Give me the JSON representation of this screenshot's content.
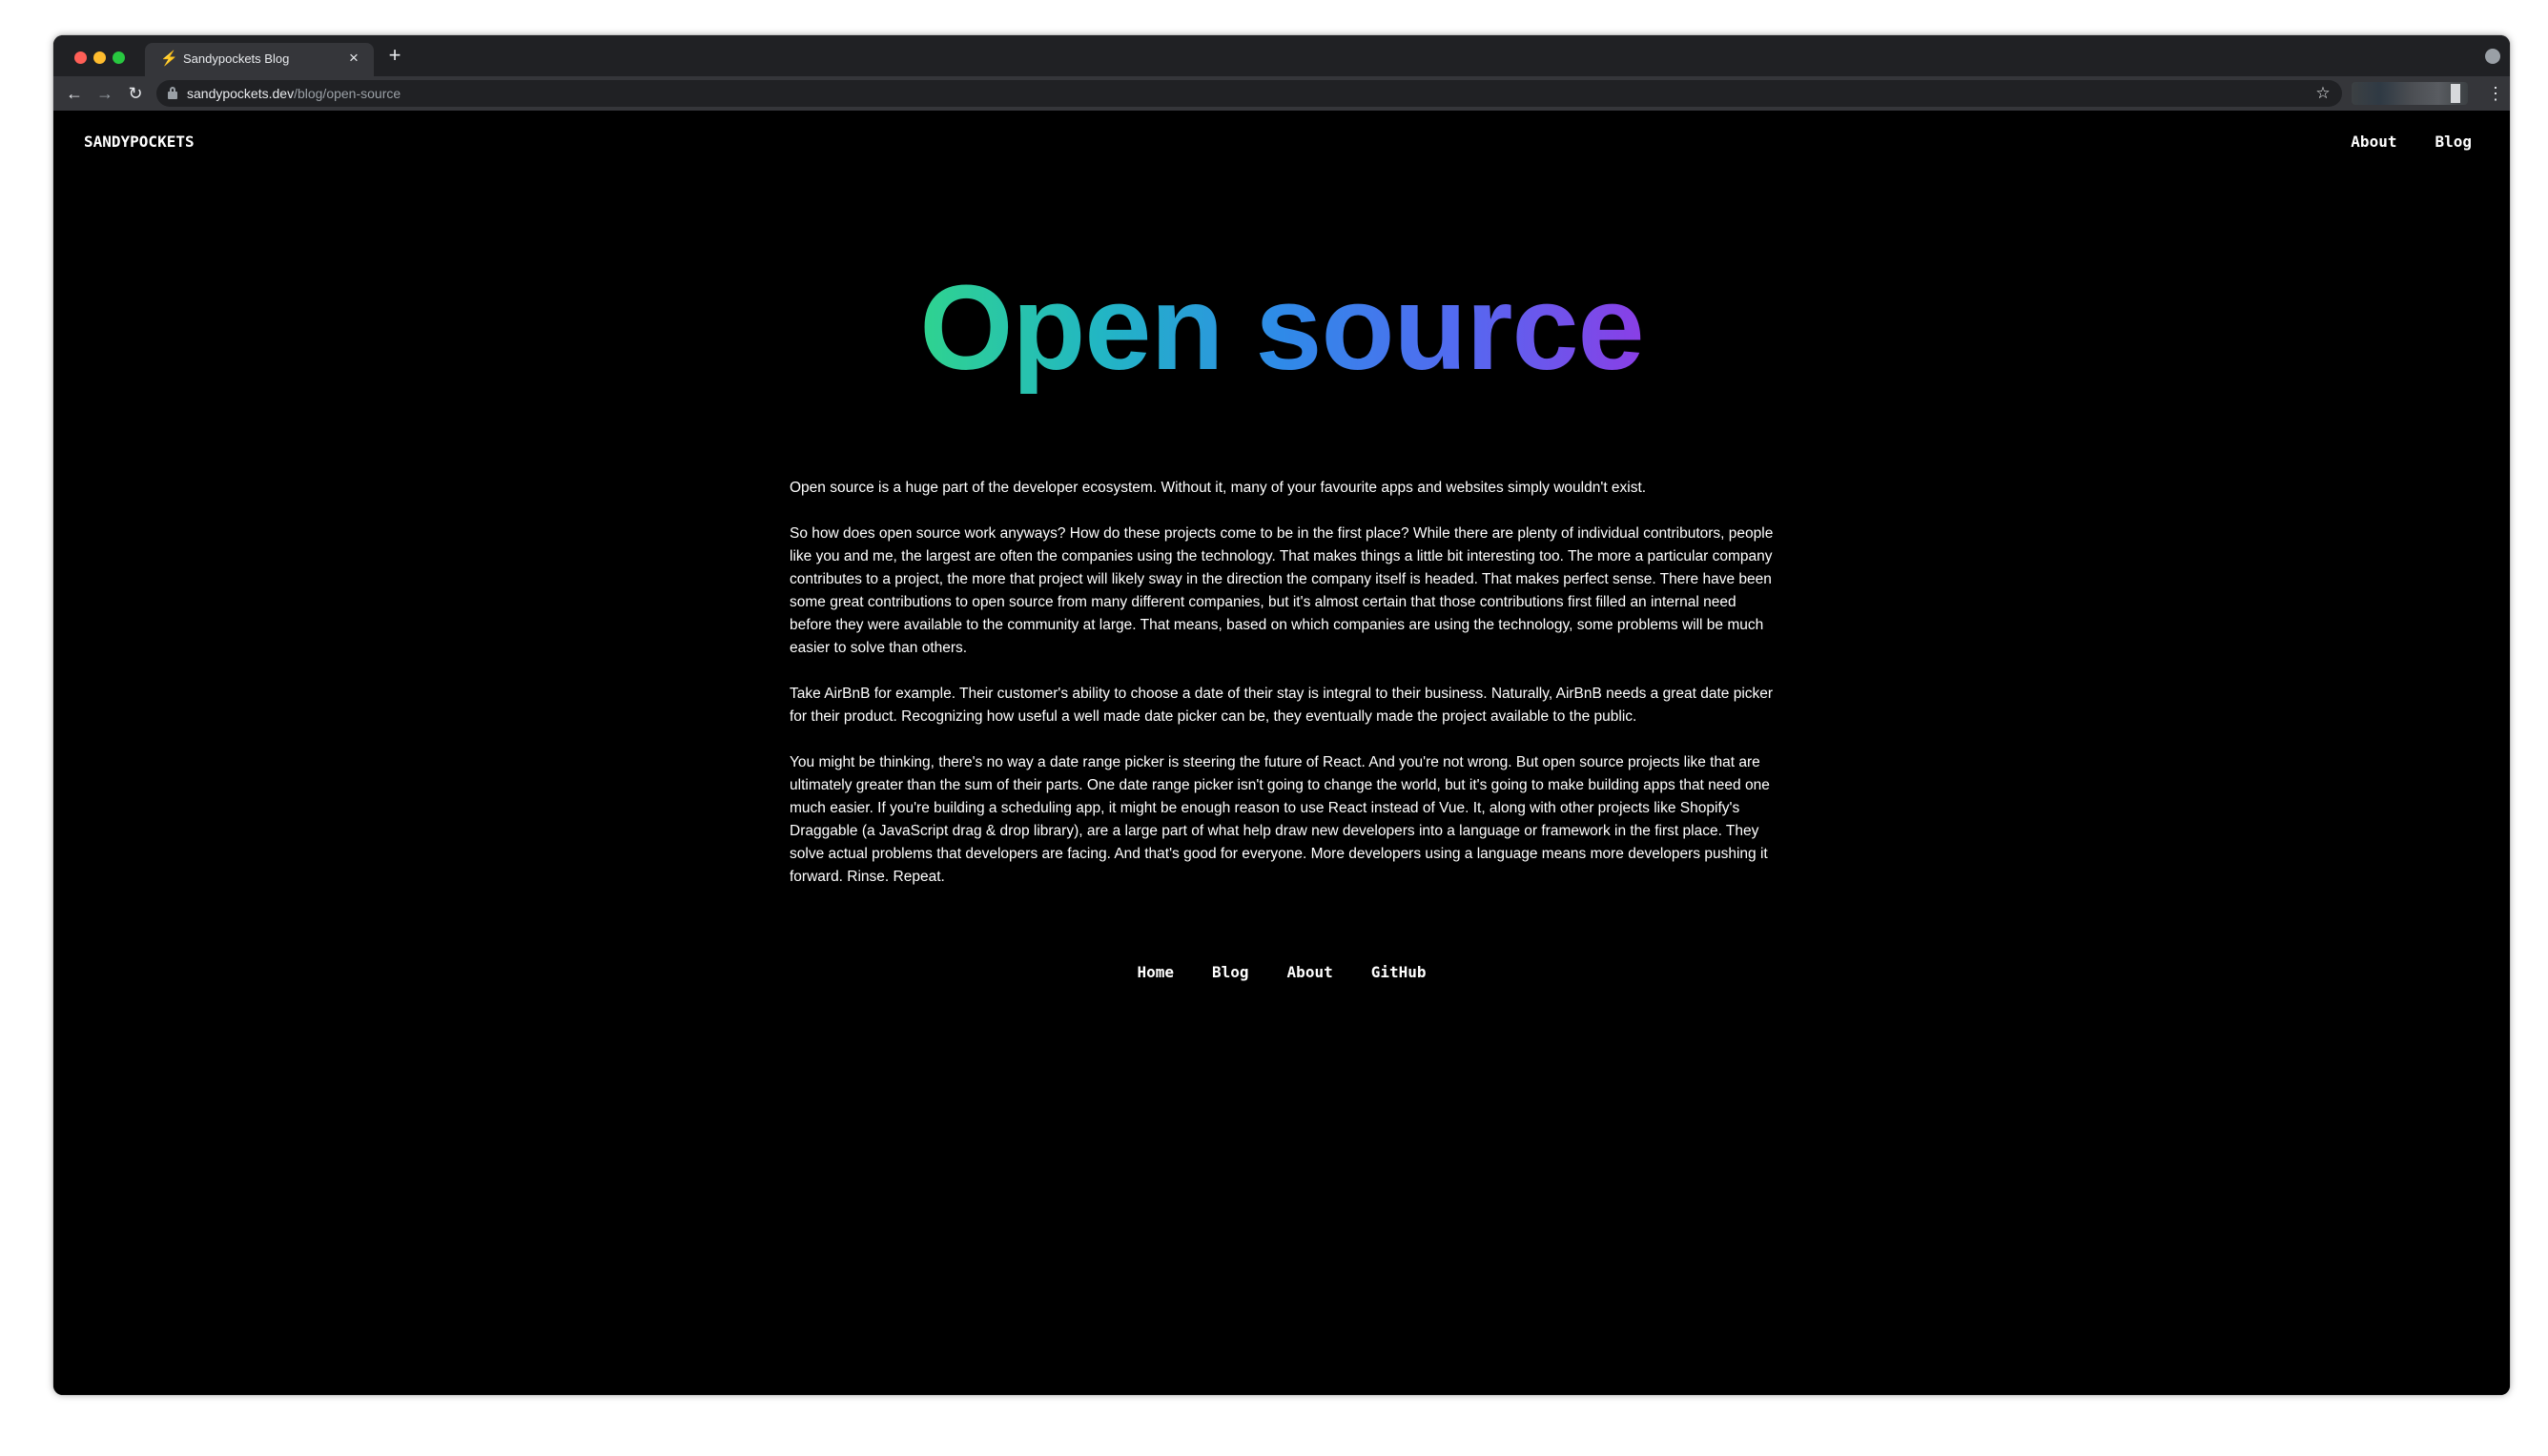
{
  "browser": {
    "tab": {
      "title": "Sandypockets Blog",
      "favicon": "lightning-bolt",
      "close_glyph": "×"
    },
    "new_tab_glyph": "+",
    "url": {
      "host": "sandypockets.dev",
      "path": "/blog/open-source"
    },
    "icons": {
      "back": "←",
      "forward": "→",
      "reload": "↻",
      "star": "☆",
      "menu": "⋮",
      "favicon": "⚡",
      "profile": "●"
    }
  },
  "site": {
    "logo": "SANDYPOCKETS",
    "top_nav": [
      {
        "label": "About"
      },
      {
        "label": "Blog"
      }
    ]
  },
  "article": {
    "title": "Open source",
    "paragraphs": [
      "Open source is a huge part of the developer ecosystem. Without it, many of your favourite apps and websites simply wouldn't exist.",
      "So how does open source work anyways? How do these projects come to be in the first place? While there are plenty of individual contributors, people like you and me, the largest are often the companies using the technology. That makes things a little bit interesting too. The more a particular company contributes to a project, the more that project will likely sway in the direction the company itself is headed. That makes perfect sense. There have been some great contributions to open source from many different companies, but it's almost certain that those contributions first filled an internal need before they were available to the community at large. That means, based on which companies are using the technology, some problems will be much easier to solve than others.",
      "Take AirBnB for example. Their customer's ability to choose a date of their stay is integral to their business. Naturally, AirBnB needs a great date picker for their product. Recognizing how useful a well made date picker can be, they eventually made the project available to the public.",
      "You might be thinking, there's no way a date range picker is steering the future of React. And you're not wrong. But open source projects like that are ultimately greater than the sum of their parts. One date range picker isn't going to change the world, but it's going to make building apps that need one much easier. If you're building a scheduling app, it might be enough reason to use React instead of Vue. It, along with other projects like Shopify's Draggable (a JavaScript drag & drop library), are a large part of what help draw new developers into a language or framework in the first place. They solve actual problems that developers are facing. And that's good for everyone. More developers using a language means more developers pushing it forward. Rinse. Repeat."
    ]
  },
  "footer_nav": [
    {
      "label": "Home"
    },
    {
      "label": "Blog"
    },
    {
      "label": "About"
    },
    {
      "label": "GitHub"
    }
  ],
  "colors": {
    "page_background": "#000000",
    "text": "#ffffff",
    "title_gradient": [
      "#2fd38f",
      "#22b6c4",
      "#2f8ae8",
      "#5469f0",
      "#8a3ee6"
    ]
  }
}
